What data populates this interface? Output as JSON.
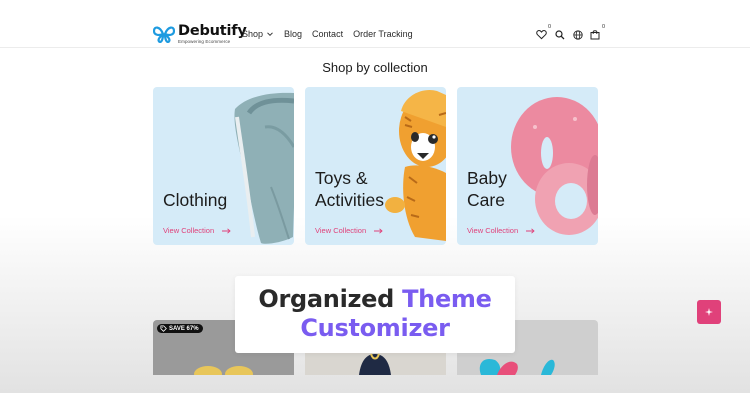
{
  "header": {
    "logo": {
      "name": "Debutify",
      "tagline": "Empowering Ecommerce"
    },
    "nav": [
      {
        "label": "Shop",
        "has_dropdown": true
      },
      {
        "label": "Blog"
      },
      {
        "label": "Contact"
      },
      {
        "label": "Order Tracking"
      }
    ],
    "wishlist_count": "0",
    "cart_count": "0"
  },
  "collections": {
    "title": "Shop by collection",
    "items": [
      {
        "title": "Clothing",
        "link": "View Collection"
      },
      {
        "title": "Toys &\nActivities",
        "link": "View Collection"
      },
      {
        "title": "Baby\nCare",
        "link": "View Collection"
      }
    ]
  },
  "overlay": {
    "word1": "Organized",
    "word2": "Theme",
    "line2": "Customizer"
  },
  "products": {
    "sale_badge": "SAVE 67%"
  },
  "colors": {
    "accent": "#e0417a",
    "card_bg": "#d5ebf8",
    "headline_purple": "#7a5cf0"
  }
}
